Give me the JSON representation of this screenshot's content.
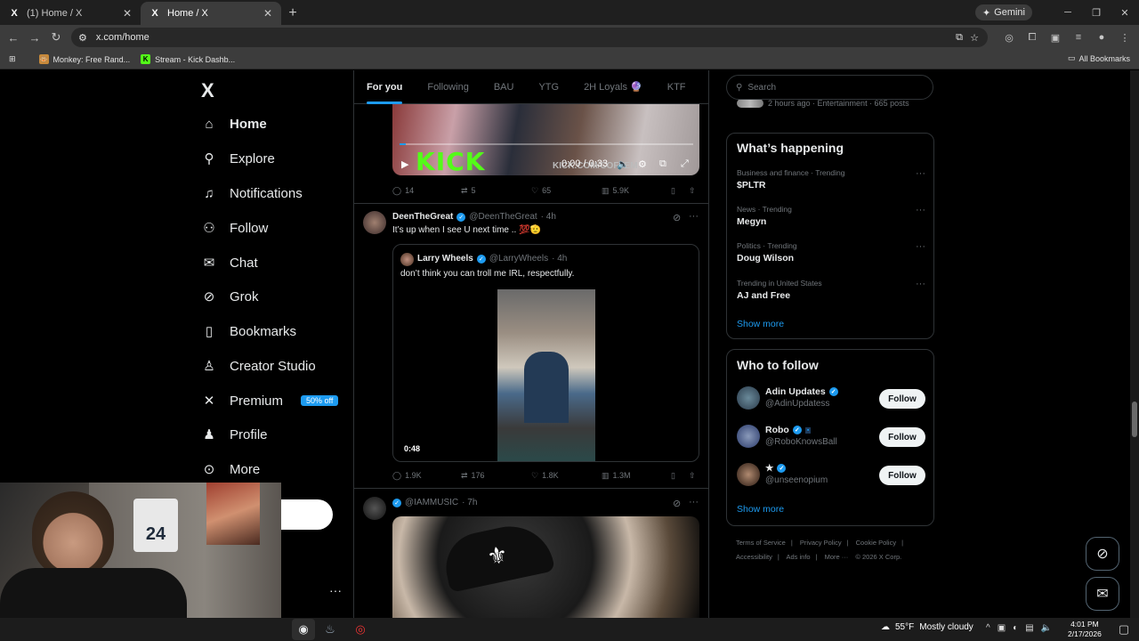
{
  "browser": {
    "tabs": [
      {
        "title": "(1) Home / X",
        "favicon": "X",
        "active": false
      },
      {
        "title": "Home / X",
        "favicon": "X",
        "active": true
      }
    ],
    "gemini_label": "Gemini",
    "url": "x.com/home",
    "bookmarks": [
      {
        "label": "Monkey: Free Rand...",
        "icon": "monkey-icon"
      },
      {
        "label": "Stream - Kick Dashb...",
        "icon": "kick-icon"
      }
    ],
    "all_bookmarks_label": "All Bookmarks"
  },
  "nav": {
    "logo": "X",
    "items": [
      {
        "label": "Home",
        "icon": "home-icon"
      },
      {
        "label": "Explore",
        "icon": "search-icon"
      },
      {
        "label": "Notifications",
        "icon": "bell-icon"
      },
      {
        "label": "Follow",
        "icon": "person-plus-icon"
      },
      {
        "label": "Chat",
        "icon": "mail-icon"
      },
      {
        "label": "Grok",
        "icon": "grok-icon"
      },
      {
        "label": "Bookmarks",
        "icon": "bookmark-icon"
      },
      {
        "label": "Creator Studio",
        "icon": "creator-studio-icon"
      },
      {
        "label": "Premium",
        "icon": "x-premium-icon",
        "badge": "50% off"
      },
      {
        "label": "Profile",
        "icon": "person-icon"
      },
      {
        "label": "More",
        "icon": "more-circle-icon"
      }
    ]
  },
  "timeline": {
    "tabs": [
      "For you",
      "Following",
      "BAU",
      "YTG",
      "2H Loyals 🔮",
      "KTF"
    ],
    "post1": {
      "kick_text": "KICK",
      "kick_sub": "KICK.COM/COFFEM",
      "video_time": "0:00 / 0:33",
      "actions": {
        "replies": "14",
        "reposts": "5",
        "likes": "65",
        "views": "5.9K"
      }
    },
    "post2": {
      "name": "DeenTheGreat",
      "handle": "@DeenTheGreat",
      "time": "· 4h",
      "text": "It’s up when I see U next time .. 💯🫡",
      "quote": {
        "name": "Larry Wheels",
        "handle": "@LarryWheels",
        "time": "· 4h",
        "text": "don’t think you can troll me IRL, respectfully.",
        "duration": "0:48"
      },
      "actions": {
        "replies": "1.9K",
        "reposts": "176",
        "likes": "1.8K",
        "views": "1.3M"
      }
    },
    "post3": {
      "handle": "@IAMMUSIC",
      "time": "· 7h"
    }
  },
  "right": {
    "search_placeholder": "Search",
    "trend_caption": "2 hours ago · Entertainment · 665 posts",
    "whats_happening": {
      "title": "What’s happening",
      "trends": [
        {
          "context": "Business and finance · Trending",
          "name": "$PLTR"
        },
        {
          "context": "News · Trending",
          "name": "Megyn"
        },
        {
          "context": "Politics · Trending",
          "name": "Doug Wilson"
        },
        {
          "context": "Trending in United States",
          "name": "AJ and Free"
        }
      ],
      "show_more": "Show more"
    },
    "who_to_follow": {
      "title": "Who to follow",
      "accounts": [
        {
          "name": "Adin Updates",
          "handle": "@AdinUpdatess",
          "button": "Follow"
        },
        {
          "name": "Robo",
          "handle": "@RoboKnowsBall",
          "button": "Follow"
        },
        {
          "name": "★",
          "handle": "@unseenopium",
          "button": "Follow"
        }
      ],
      "show_more": "Show more"
    },
    "footer": [
      "Terms of Service",
      "|",
      "Privacy Policy",
      "|",
      "Cookie Policy",
      "|",
      "Accessibility",
      "|",
      "Ads info",
      "|",
      "More ···",
      "© 2026 X Corp."
    ]
  },
  "webcam": {
    "jersey": "24"
  },
  "taskbar": {
    "weather_temp": "55°F",
    "weather_desc": "Mostly cloudy",
    "time": "4:01 PM",
    "date": "2/17/2026"
  }
}
